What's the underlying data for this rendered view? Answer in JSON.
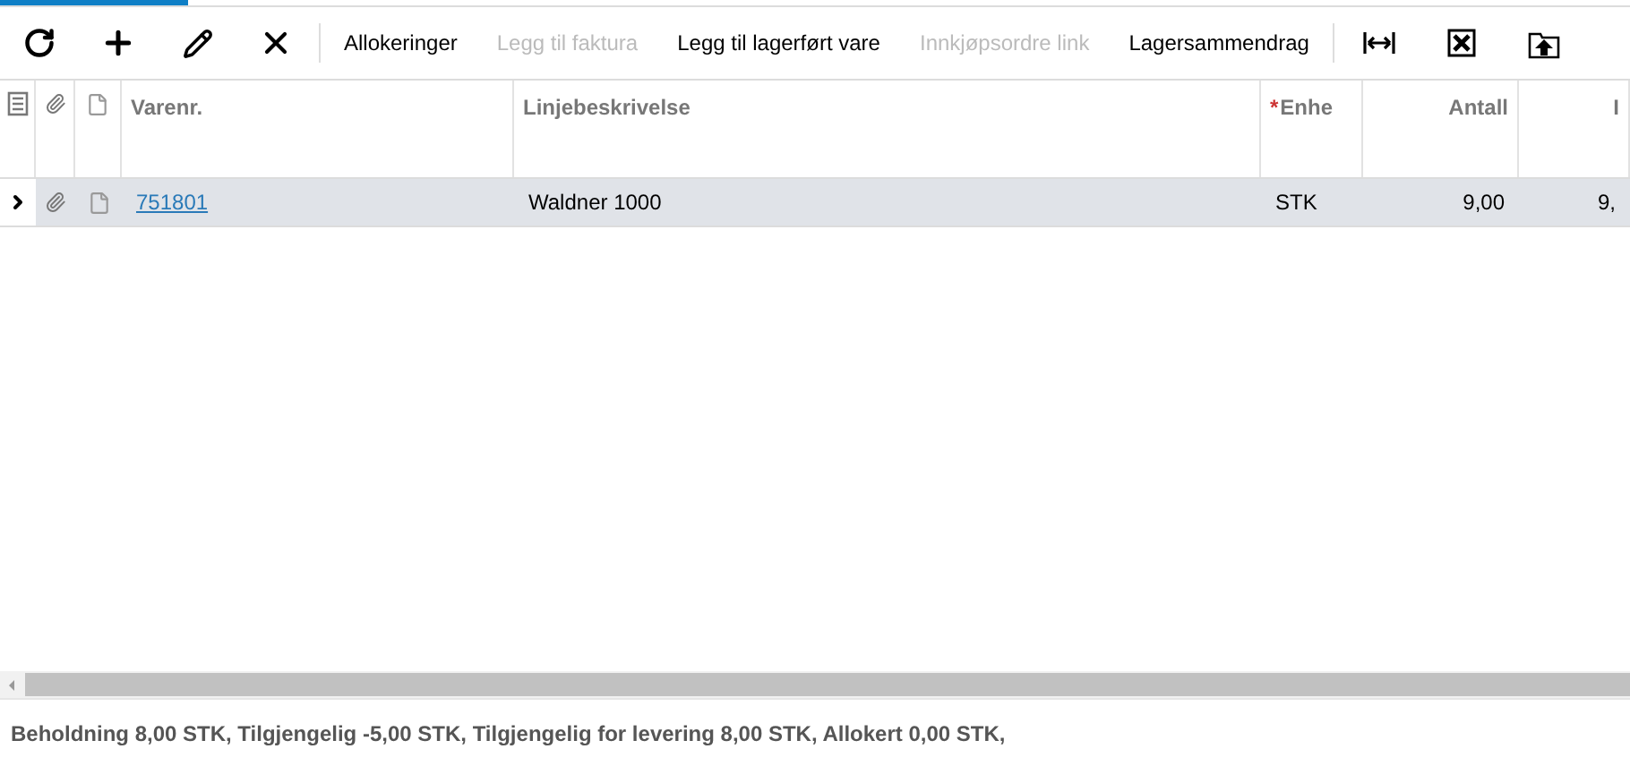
{
  "toolbar": {
    "left_icons": [
      {
        "kind": "refresh"
      },
      {
        "kind": "add"
      },
      {
        "kind": "edit"
      },
      {
        "kind": "delete"
      }
    ],
    "actions": [
      {
        "label": "Allokeringer",
        "disabled": false
      },
      {
        "label": "Legg til faktura",
        "disabled": true
      },
      {
        "label": "Legg til lagerført vare",
        "disabled": false
      },
      {
        "label": "Innkjøpsordre link",
        "disabled": true
      },
      {
        "label": "Lagersammendrag",
        "disabled": false
      }
    ],
    "right_icons": [
      {
        "kind": "fit"
      },
      {
        "kind": "excel"
      },
      {
        "kind": "upload"
      }
    ]
  },
  "table": {
    "columns": [
      {
        "label": "Varenr."
      },
      {
        "label": "Linjebeskrivelse"
      },
      {
        "label": "Enhe",
        "required_mark": "*"
      },
      {
        "label": "Antall"
      },
      {
        "label": "I"
      }
    ],
    "rows": [
      {
        "selected": true,
        "cells": [
          "751801",
          "Waldner 1000",
          "STK",
          "9,00",
          "9,"
        ]
      }
    ]
  },
  "status_bar": "Beholdning 8,00 STK, Tilgjengelig -5,00 STK, Tilgjengelig for levering 8,00 STK, Allokert 0,00 STK,"
}
